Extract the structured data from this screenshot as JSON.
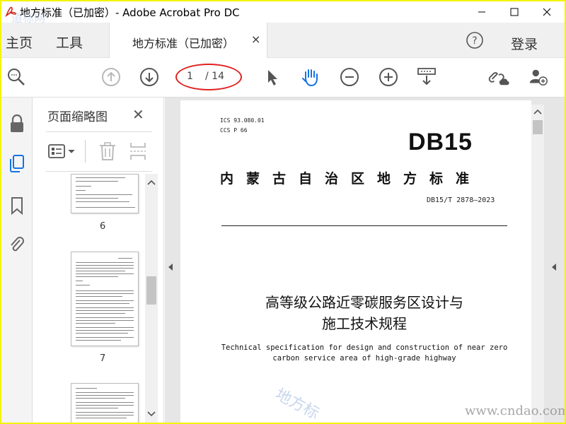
{
  "window": {
    "title": "地方标准（已加密）- Adobe Acrobat Pro DC"
  },
  "menu": {
    "home": "主页",
    "tools": "工具",
    "doc_tab": "地方标准（已加密）",
    "doc_tab_close": "×",
    "login": "登录"
  },
  "toolbar": {
    "page_current": "1",
    "page_total": "/ 14",
    "icons": [
      "zoom-marquee-icon",
      "page-up-icon",
      "page-down-icon",
      "select-arrow-icon",
      "hand-tool-icon",
      "zoom-out-icon",
      "zoom-in-icon",
      "scroll-mode-icon",
      "share-link-icon",
      "add-user-icon"
    ]
  },
  "sidebar": {
    "icons": [
      "lock-icon",
      "pages-icon",
      "bookmark-icon",
      "attachment-icon"
    ]
  },
  "thumbnails": {
    "title": "页面缩略图",
    "close": "✕",
    "pages": [
      {
        "number": "6"
      },
      {
        "number": "7"
      }
    ]
  },
  "document": {
    "ics": "ICS  93.080.01",
    "ccs": "CCS P 66",
    "code": "DB15",
    "region": "内蒙古自治区地方标准",
    "std_no": "DB15/T 2878—2023",
    "title_cn_line1": "高等级公路近零碳服务区设计与",
    "title_cn_line2": "施工技术规程",
    "title_en_line1": "Technical specification for design and construction of near zero",
    "title_en_line2": "carbon service area of high-grade highway"
  },
  "watermarks": {
    "url": "www.cndao.com",
    "diagonal": "地方标",
    "corner": "道标网"
  },
  "colors": {
    "frame": "#f4f400",
    "annotation": "#e02020",
    "hand_tool": "#1473e6"
  }
}
